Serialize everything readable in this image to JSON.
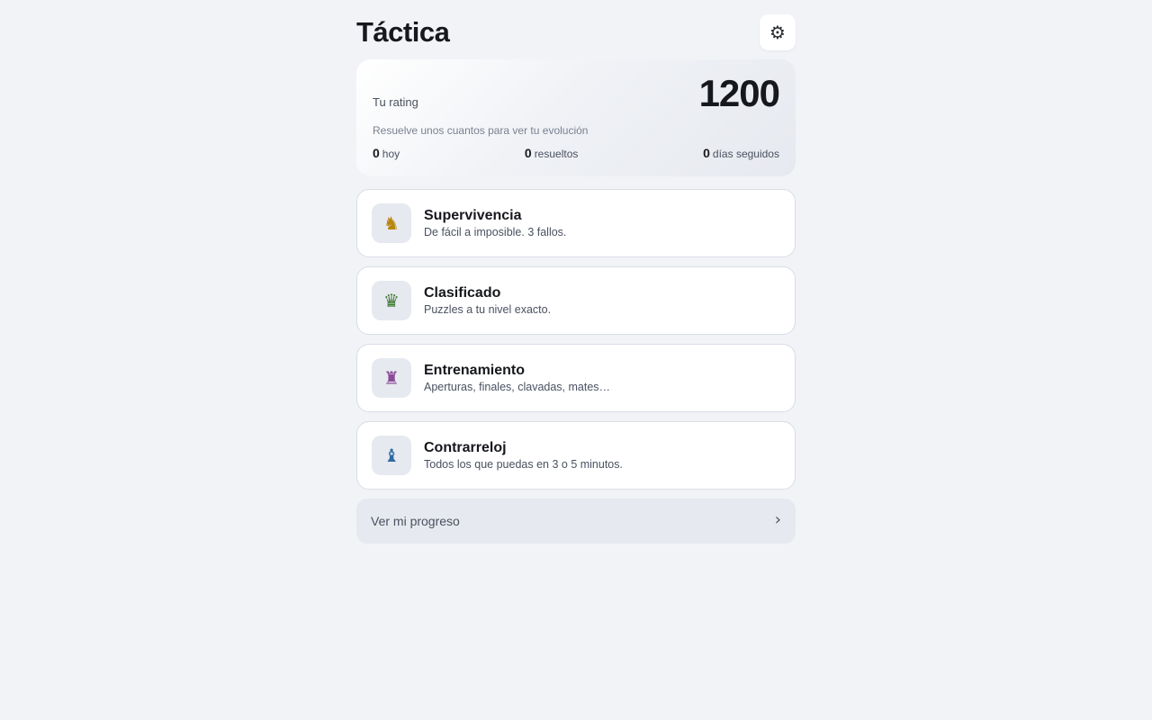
{
  "header": {
    "title": "Táctica",
    "settings_icon": "⚙"
  },
  "rating": {
    "label": "Tu rating",
    "value": "1200",
    "hint": "Resuelve unos cuantos para ver tu evolución",
    "stats": [
      {
        "value": "0",
        "label": "hoy"
      },
      {
        "value": "0",
        "label": "resueltos"
      },
      {
        "value": "0",
        "label": "días seguidos"
      }
    ]
  },
  "modes": [
    {
      "icon": "♞",
      "icon_name": "knight-icon",
      "icon_color": "#b8860b",
      "title": "Supervivencia",
      "desc": "De fácil a imposible. 3 fallos."
    },
    {
      "icon": "♛",
      "icon_name": "queen-icon",
      "icon_color": "#3f7a33",
      "title": "Clasificado",
      "desc": "Puzzles a tu nivel exacto."
    },
    {
      "icon": "♜",
      "icon_name": "rook-icon",
      "icon_color": "#8a4a96",
      "title": "Entrenamiento",
      "desc": "Aperturas, finales, clavadas, mates…"
    },
    {
      "icon": "♝",
      "icon_name": "bishop-icon",
      "icon_color": "#2f6aa3",
      "title": "Contrarreloj",
      "desc": "Todos los que puedas en 3 o 5 minutos."
    }
  ],
  "progress": {
    "label": "Ver mi progreso",
    "chevron": "›"
  }
}
